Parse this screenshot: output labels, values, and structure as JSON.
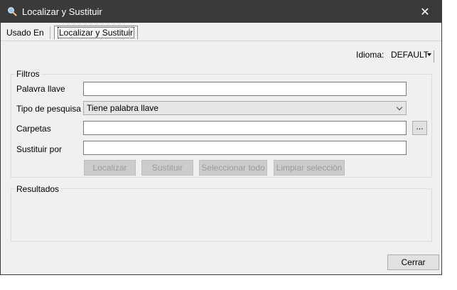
{
  "window": {
    "title": "Localizar y Sustituir",
    "close_glyph": "✕",
    "icon": "search-icon"
  },
  "tabs": [
    {
      "label": "Usado En"
    },
    {
      "label": "Localizar y Sustituir",
      "active": true
    }
  ],
  "language": {
    "label": "Idioma:",
    "value": "DEFAULT"
  },
  "filters": {
    "title": "Filtros",
    "keyword_label": "Palavra llave",
    "keyword_value": "",
    "search_type_label": "Tipo de pesquisa",
    "search_type_value": "Tiene palabra llave",
    "folders_label": "Carpetas",
    "folders_value": "",
    "browse_label": "...",
    "replace_label": "Sustituir por",
    "replace_value": ""
  },
  "actions": {
    "find": "Localizar",
    "replace": "Sustituir",
    "select_all": "Seleccionar todo",
    "clear_selection": "Limpiar selección"
  },
  "results": {
    "title": "Resultados"
  },
  "footer": {
    "close_label": "Cerrar"
  }
}
